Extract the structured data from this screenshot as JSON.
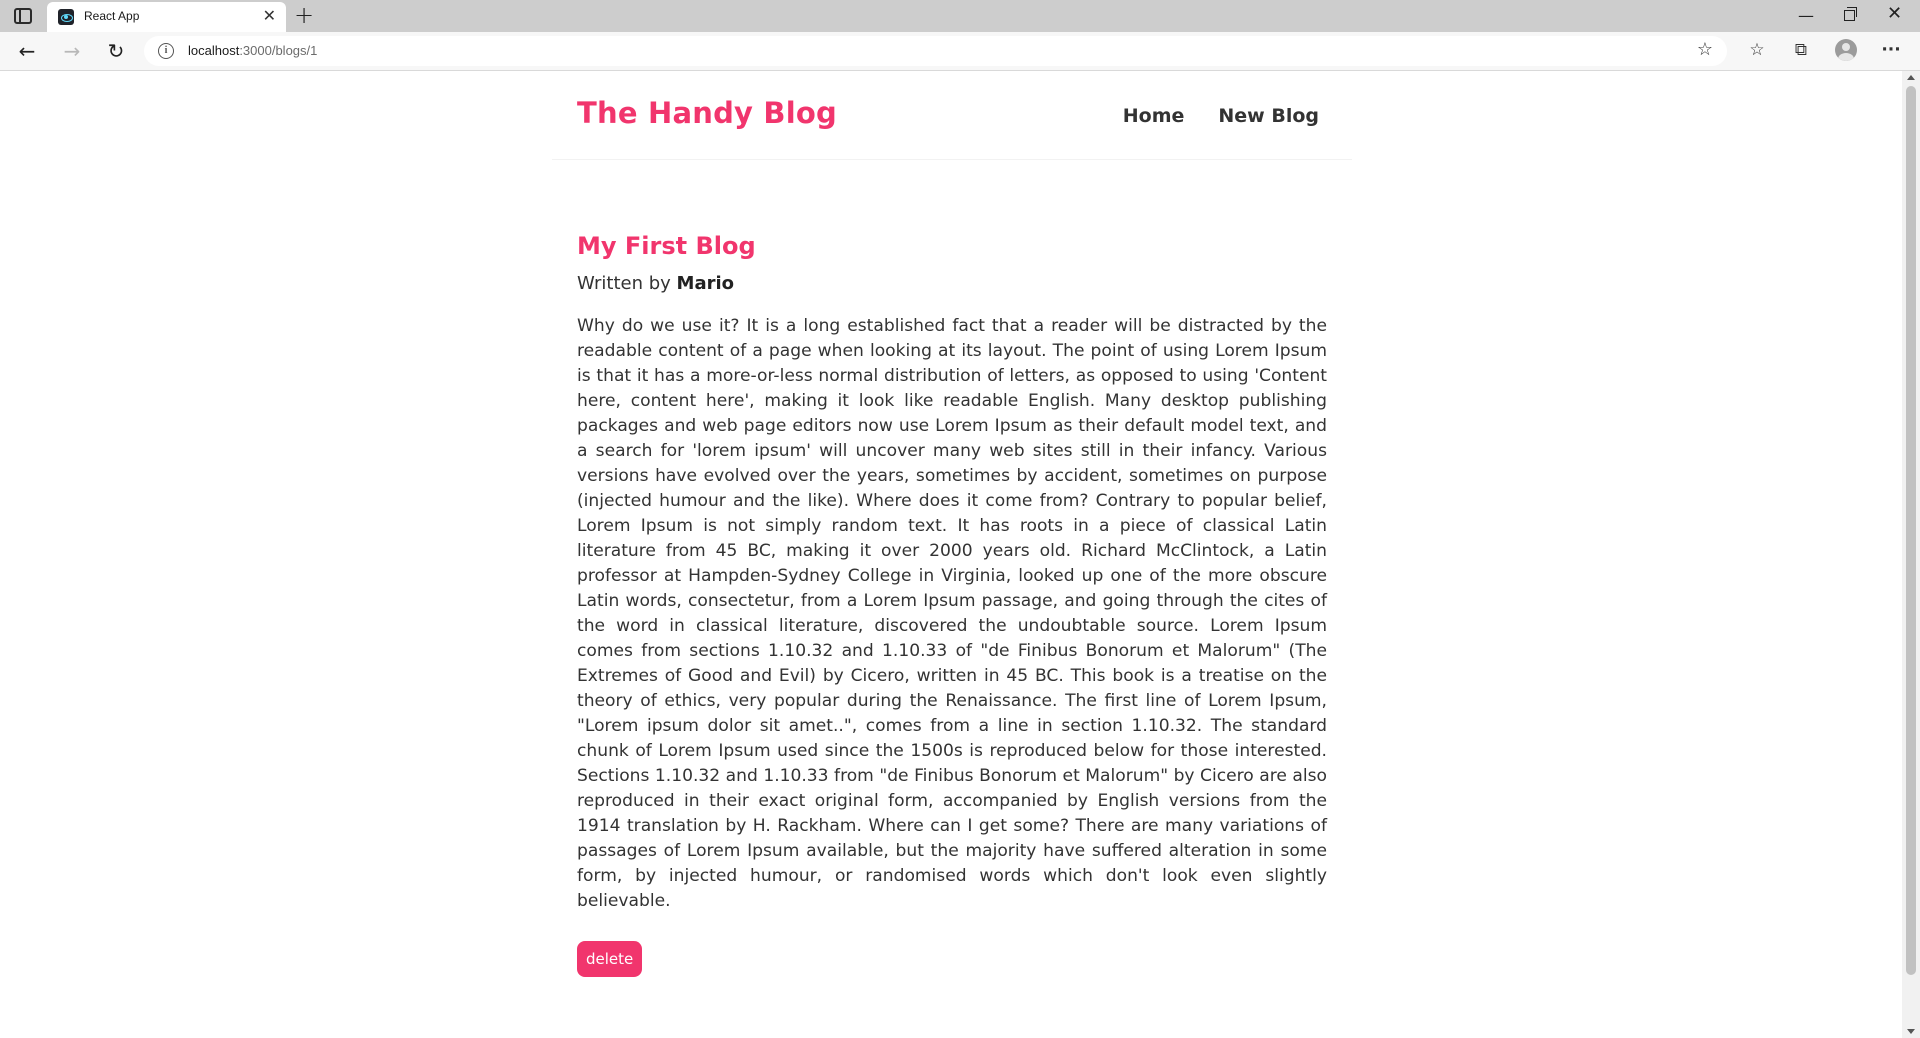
{
  "browser": {
    "tab": {
      "title": "React App",
      "close_glyph": "✕",
      "favicon": "react-icon"
    },
    "new_tab_glyph": "+",
    "address": {
      "host": "localhost",
      "path": ":3000/blogs/1"
    },
    "icons": {
      "back": "←",
      "forward": "→",
      "reload": "↻",
      "info": "i",
      "add_favorite": "☆",
      "favorites": "☆",
      "collections": "⧉",
      "menu": "···",
      "minimize": "—",
      "close": "✕"
    }
  },
  "site": {
    "brand": "The Handy Blog",
    "nav": [
      {
        "label": "Home"
      },
      {
        "label": "New Blog"
      }
    ]
  },
  "blog": {
    "title": "My First Blog",
    "byline_prefix": "Written by",
    "author": "Mario",
    "body": "Why do we use it? It is a long established fact that a reader will be distracted by the readable content of a page when looking at its layout. The point of using Lorem Ipsum is that it has a more-or-less normal distribution of letters, as opposed to using 'Content here, content here', making it look like readable English. Many desktop publishing packages and web page editors now use Lorem Ipsum as their default model text, and a search for 'lorem ipsum' will uncover many web sites still in their infancy. Various versions have evolved over the years, sometimes by accident, sometimes on purpose (injected humour and the like). Where does it come from? Contrary to popular belief, Lorem Ipsum is not simply random text. It has roots in a piece of classical Latin literature from 45 BC, making it over 2000 years old. Richard McClintock, a Latin professor at Hampden-Sydney College in Virginia, looked up one of the more obscure Latin words, consectetur, from a Lorem Ipsum passage, and going through the cites of the word in classical literature, discovered the undoubtable source. Lorem Ipsum comes from sections 1.10.32 and 1.10.33 of \"de Finibus Bonorum et Malorum\" (The Extremes of Good and Evil) by Cicero, written in 45 BC. This book is a treatise on the theory of ethics, very popular during the Renaissance. The first line of Lorem Ipsum, \"Lorem ipsum dolor sit amet..\", comes from a line in section 1.10.32. The standard chunk of Lorem Ipsum used since the 1500s is reproduced below for those interested. Sections 1.10.32 and 1.10.33 from \"de Finibus Bonorum et Malorum\" by Cicero are also reproduced in their exact original form, accompanied by English versions from the 1914 translation by H. Rackham. Where can I get some? There are many variations of passages of Lorem Ipsum available, but the majority have suffered alteration in some form, by injected humour, or randomised words which don't look even slightly believable.",
    "delete_label": "delete"
  },
  "colors": {
    "accent": "#f1356d",
    "text": "#333333",
    "tabstrip": "#cdcdcd",
    "toolbar": "#f7f7f7"
  }
}
